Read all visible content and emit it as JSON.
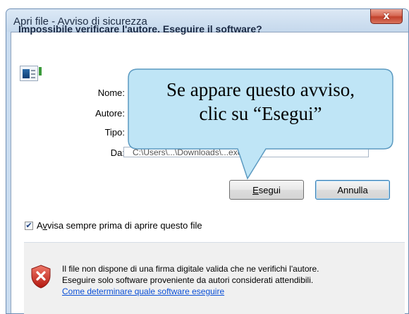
{
  "window": {
    "title": "Apri file - Avviso di sicurezza",
    "close_symbol": "x"
  },
  "dialog": {
    "heading": "Impossibile verificare l'autore. Eseguire il software?",
    "fields": {
      "nome_label": "Nome:",
      "autore_label": "Autore:",
      "tipo_label": "Tipo:",
      "da_label": "Da:",
      "da_value": "C:\\Users\\...\\Downloads\\...exe"
    },
    "buttons": {
      "run_prefix": "E",
      "run_rest": "segui",
      "cancel": "Annulla"
    },
    "checkbox": {
      "checked": true,
      "label_prefix": "A",
      "label_accel": "v",
      "label_rest": "visa sempre prima di aprire questo file"
    },
    "warning": {
      "line1": "Il file non dispone di una firma digitale valida che ne verifichi l'autore.",
      "line2": "Eseguire solo software proveniente da autori considerati attendibili.",
      "link": "Come determinare quale software eseguire"
    }
  },
  "callout": {
    "line1": "Se appare questo avviso,",
    "line2": "clic su “Esegui”"
  },
  "colors": {
    "callout_fill": "#bfe5f6",
    "callout_border": "#5c9ac1",
    "link": "#0a4fd6"
  }
}
